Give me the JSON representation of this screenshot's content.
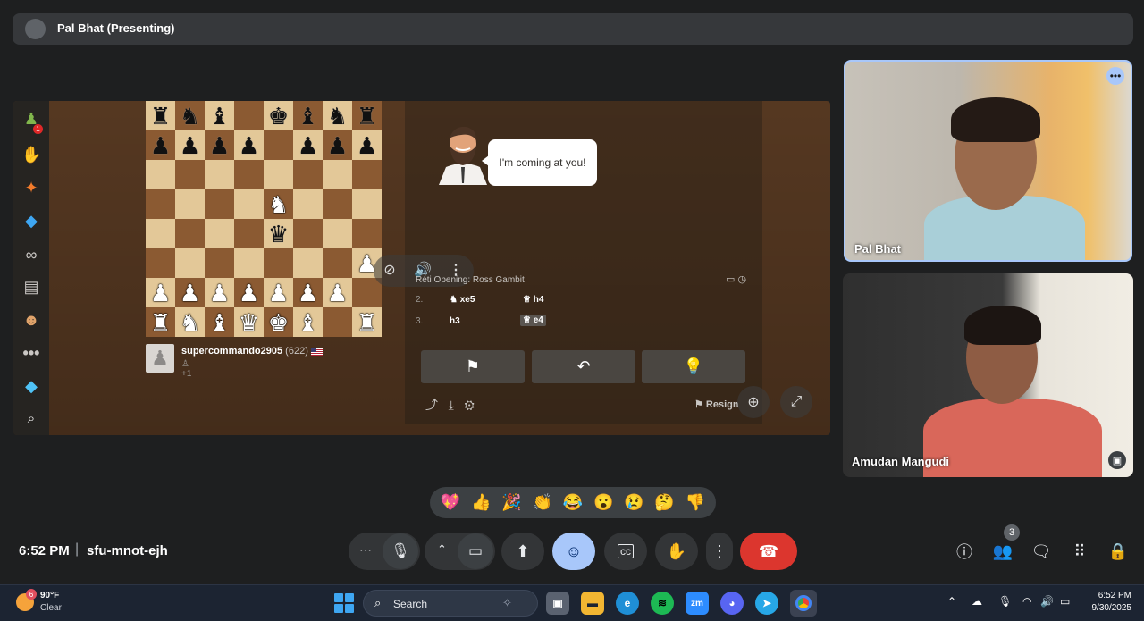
{
  "presenter": {
    "label": "Pal Bhat (Presenting)"
  },
  "chess": {
    "sidebar_icons": [
      "pawn-icon",
      "hand-piece-icon",
      "puzzle-icon",
      "lesson-icon",
      "binoculars-icon",
      "news-icon",
      "friends-icon",
      "more-icon",
      "diamond-icon",
      "search-icon"
    ],
    "sidebar_badge": "1",
    "board": [
      [
        "r",
        "n",
        "b",
        "",
        "k",
        "b",
        "n",
        "r"
      ],
      [
        "p",
        "p",
        "p",
        "p",
        "",
        "p",
        "p",
        "p"
      ],
      [
        "",
        "",
        "",
        "",
        "",
        "",
        "",
        ""
      ],
      [
        "",
        "",
        "",
        "",
        "N",
        "",
        "",
        ""
      ],
      [
        "",
        "",
        "",
        "",
        "q",
        "",
        "",
        ""
      ],
      [
        "",
        "",
        "",
        "",
        "",
        "",
        "",
        "P"
      ],
      [
        "P",
        "P",
        "P",
        "P",
        "P",
        "P",
        "P",
        ""
      ],
      [
        "R",
        "N",
        "B",
        "Q",
        "K",
        "B",
        "",
        "R"
      ]
    ],
    "player": {
      "name": "supercommando2905",
      "rating": "(622)",
      "sub": "+1"
    },
    "coach_message": "I'm coming at you!",
    "opening": "Réti Opening: Ross Gambit",
    "moves": [
      {
        "num": "2.",
        "white": "xe5",
        "black": "h4"
      },
      {
        "num": "3.",
        "white": "h3",
        "black": "e4"
      }
    ],
    "resign_label": "Resign"
  },
  "participants": [
    {
      "name": "Pal Bhat"
    },
    {
      "name": "Amudan Mangudi"
    }
  ],
  "reactions": [
    "💖",
    "👍",
    "🎉",
    "👏",
    "😂",
    "😮",
    "😢",
    "🤔",
    "👎"
  ],
  "meet": {
    "time": "6:52 PM",
    "separator": "|",
    "code": "sfu-mnot-ejh",
    "people_count": "3"
  },
  "taskbar": {
    "weather_temp": "90°F",
    "weather_cond": "Clear",
    "weather_badge": "6",
    "search_label": "Search",
    "time": "6:52 PM",
    "date": "9/30/2025"
  }
}
